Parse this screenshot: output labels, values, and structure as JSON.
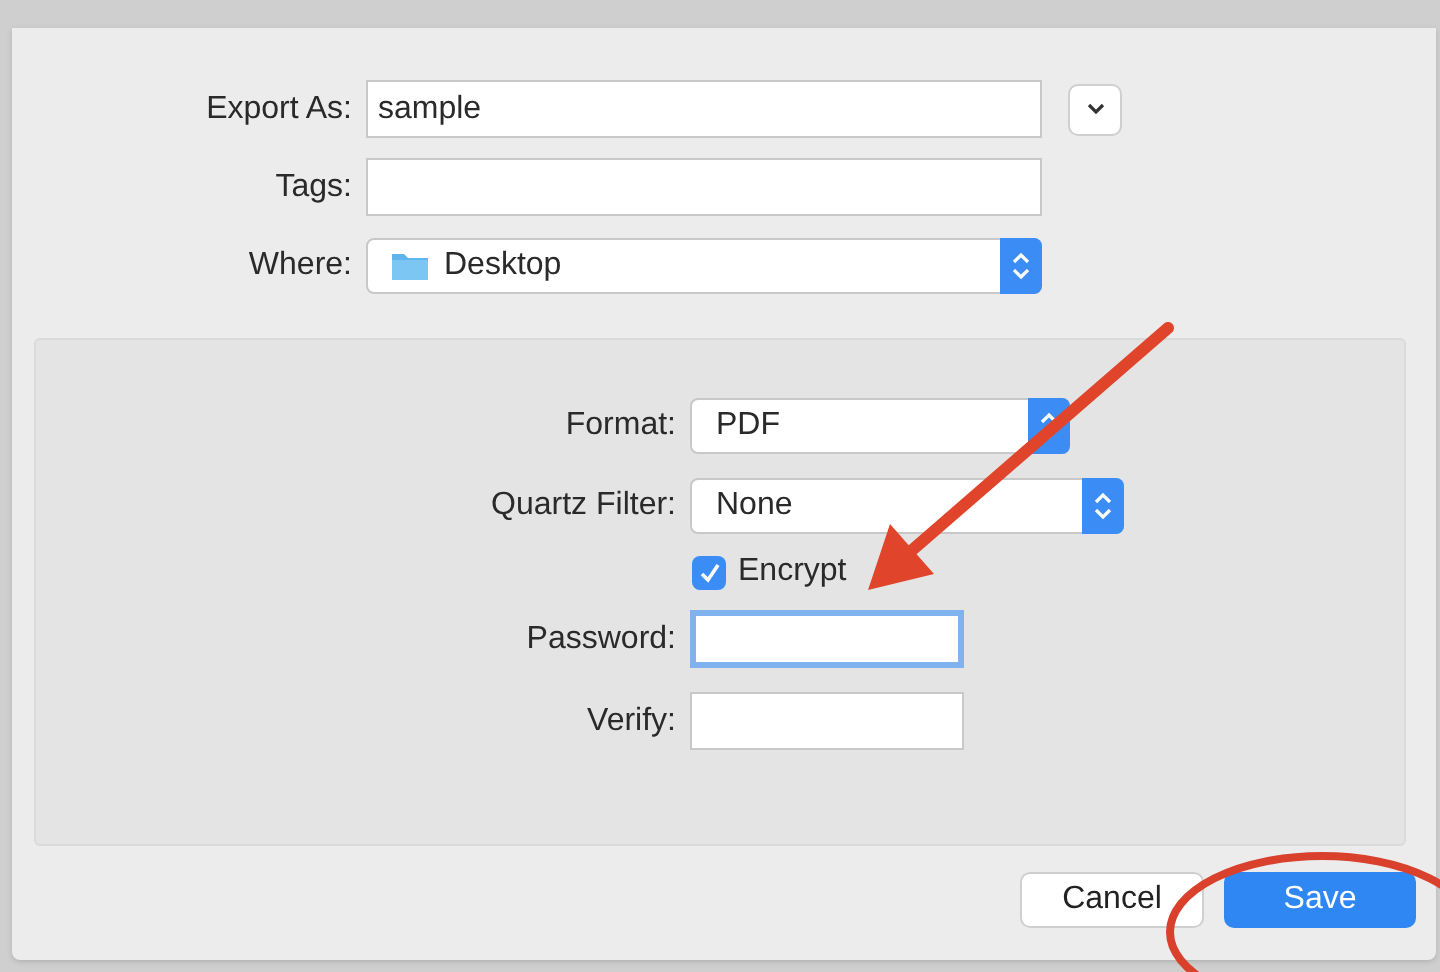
{
  "top_rows": [
    {
      "kind": "text",
      "label": "Export As:",
      "value": "sample"
    },
    {
      "kind": "text",
      "label": "Tags:"
    },
    {
      "kind": "folder-popup",
      "label": "Where:",
      "value": "Desktop"
    }
  ],
  "option_rows": [
    {
      "kind": "popup",
      "label": "Format:",
      "value": "PDF"
    },
    {
      "kind": "popup",
      "label": "Quartz Filter:",
      "value": "None"
    },
    {
      "kind": "checkbox",
      "label": "Encrypt",
      "checked": true
    },
    {
      "kind": "password",
      "label": "Password:",
      "focused": true
    },
    {
      "kind": "password",
      "label": "Verify:",
      "focused": false
    }
  ],
  "buttons": [
    {
      "label": "Cancel",
      "default": false
    },
    {
      "label": "Save",
      "default": true
    }
  ]
}
